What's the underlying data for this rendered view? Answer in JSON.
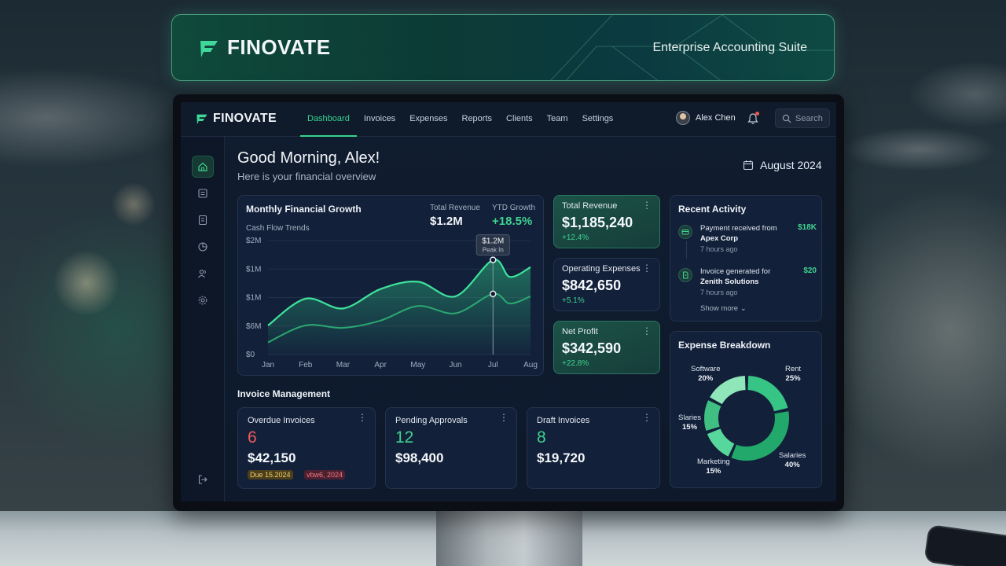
{
  "banner": {
    "brand": "FINOVATE",
    "tagline": "Enterprise Accounting Suite"
  },
  "nav": {
    "brand": "FINOVATE",
    "links": [
      "Dashboard",
      "Invoices",
      "Expenses",
      "Reports",
      "Clients",
      "Team",
      "Settings"
    ],
    "active": "Dashboard",
    "user_name": "Alex Chen",
    "search_placeholder": "Search"
  },
  "sidebar": {
    "icons": [
      "home-icon",
      "invoice-icon",
      "checklist-icon",
      "pie-chart-icon",
      "users-icon",
      "gear-icon"
    ],
    "bottom_icon": "logout-icon"
  },
  "header": {
    "greeting": "Good Morning, Alex!",
    "subtitle": "Here is your financial overview",
    "date": "August 2024"
  },
  "growth": {
    "title": "Monthly Financial Growth",
    "subtitle": "Cash Flow Trends",
    "total_revenue_label": "Total Revenue",
    "total_revenue_value": "$1.2M",
    "ytd_label": "YTD Growth",
    "ytd_value": "+18.5%",
    "tooltip_value": "$1.2M",
    "tooltip_label": "Peak In"
  },
  "chart_data": {
    "type": "area",
    "title": "Monthly Financial Growth",
    "subtitle": "Cash Flow Trends",
    "categories": [
      "Jan",
      "Feb",
      "Mar",
      "Apr",
      "May",
      "Jun",
      "Jul",
      "Aug"
    ],
    "y_tick_labels": [
      "$2M",
      "$1M",
      "$1M",
      "$6M",
      "$0"
    ],
    "series": [
      {
        "values": [
          0.6,
          1.15,
          0.95,
          1.35,
          1.5,
          1.2,
          1.95,
          1.6,
          1.8
        ]
      },
      {
        "values": [
          0.25,
          0.6,
          0.55,
          0.7,
          1.0,
          0.85,
          1.25,
          1.05,
          1.2
        ]
      }
    ],
    "x_positions": [
      0,
      1,
      2,
      3,
      4,
      5,
      6,
      6.45,
      7
    ],
    "highlight": {
      "category": "Jul",
      "value": 1.95,
      "label": "$1.2M",
      "sublabel": "Peak In"
    },
    "ylim": [
      0,
      2.3
    ],
    "grid": true
  },
  "stats": [
    {
      "label": "Total Revenue",
      "value": "$1,185,240",
      "change": "+12.4%",
      "highlight": true
    },
    {
      "label": "Operating Expenses",
      "value": "$842,650",
      "change": "+5.1%",
      "highlight": false
    },
    {
      "label": "Net Profit",
      "value": "$342,590",
      "change": "+22.8%",
      "highlight": true
    }
  ],
  "activity": {
    "title": "Recent Activity",
    "items": [
      {
        "text": "Payment received from",
        "bold": "Apex Corp",
        "time": "7 hours ago",
        "amount": "$18K",
        "icon": "wallet-icon"
      },
      {
        "text": "Invoice generated for",
        "bold": "Zenith Solutions",
        "time": "7 hours ago",
        "amount": "$20",
        "icon": "document-icon"
      }
    ],
    "show_more": "Show more"
  },
  "expense": {
    "title": "Expense Breakdown",
    "slices": [
      {
        "name": "Rent",
        "pct": "25%",
        "value": 25
      },
      {
        "name": "Salaries",
        "pct": "40%",
        "value": 40
      },
      {
        "name": "Marketing",
        "pct": "15%",
        "value": 15
      },
      {
        "name": "Slaries",
        "pct": "15%",
        "value": 15
      },
      {
        "name": "Software",
        "pct": "20%",
        "value": 20
      }
    ]
  },
  "invoices": {
    "heading": "Invoice Management",
    "cards": [
      {
        "label": "Overdue Invoices",
        "count": "6",
        "amount": "$42,150",
        "tag1": "Due 15.2024",
        "tag2": "vbw6, 2024",
        "count_color": "#f05c5c"
      },
      {
        "label": "Pending Approvals",
        "count": "12",
        "amount": "$98,400",
        "count_color": "#3fd28f"
      },
      {
        "label": "Draft Invoices",
        "count": "8",
        "amount": "$19,720",
        "count_color": "#3fd28f"
      }
    ]
  },
  "colors": {
    "accent": "#35d58e",
    "danger": "#f05c5c",
    "card": "#13203a",
    "screen": "#101c2f"
  }
}
